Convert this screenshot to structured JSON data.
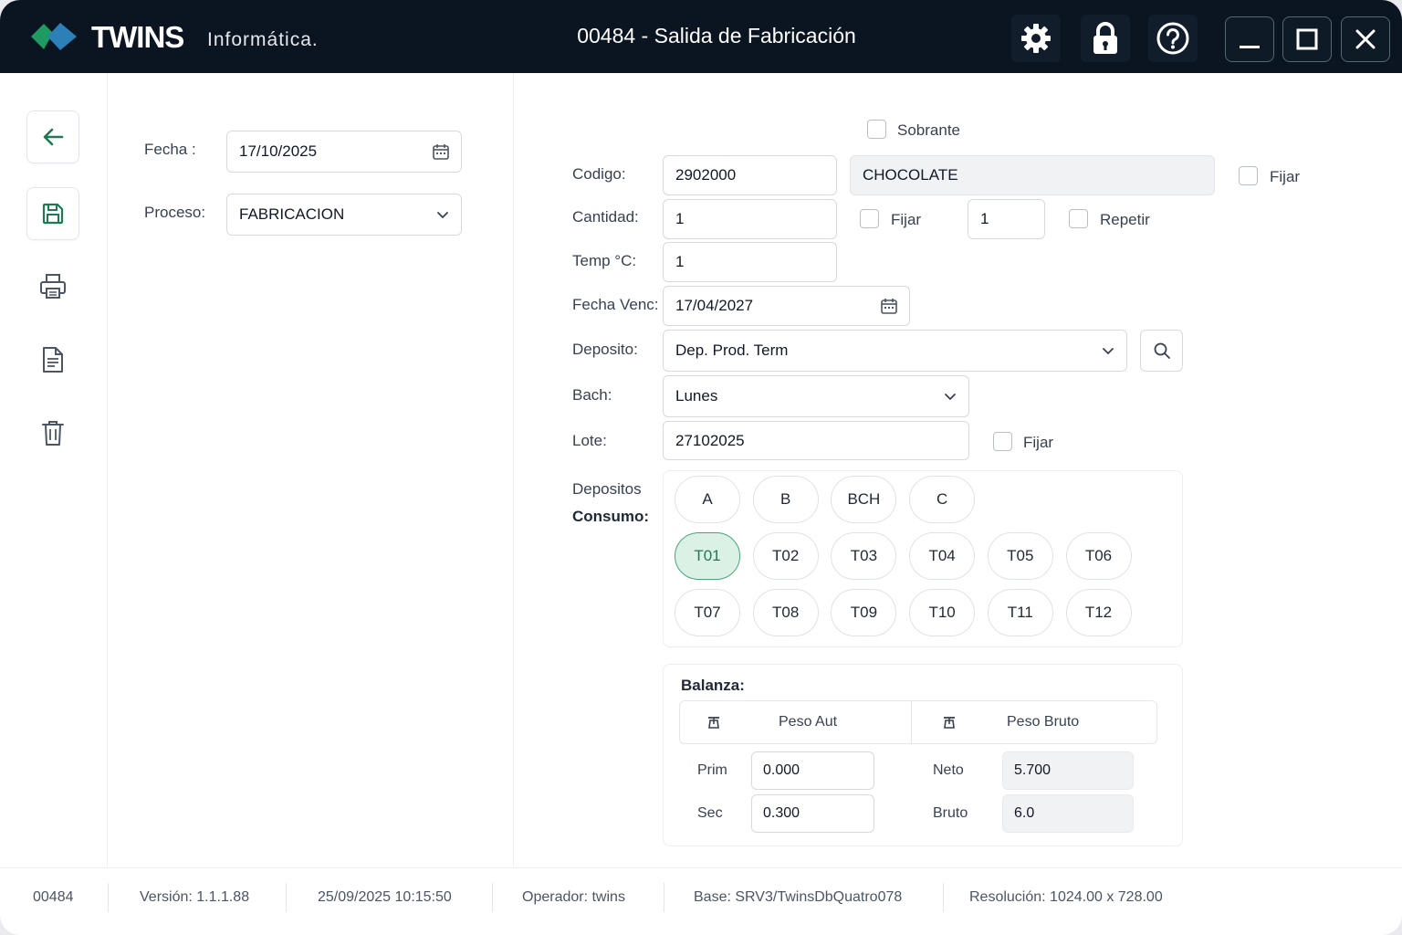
{
  "titlebar": {
    "brand": "TWINS",
    "brand_sub": "Informática.",
    "title": "00484 - Salida de Fabricación"
  },
  "icons": {
    "settings": "gear-icon",
    "lock": "lock-icon",
    "help": "help-icon",
    "minimize": "minimize-icon",
    "maximize": "maximize-icon",
    "close": "close-icon",
    "back": "arrow-left-icon",
    "save": "save-icon",
    "print": "printer-icon",
    "document": "document-icon",
    "delete": "trash-icon"
  },
  "left": {
    "fecha_label": "Fecha :",
    "fecha_value": "17/10/2025",
    "proceso_label": "Proceso:",
    "proceso_value": "FABRICACION"
  },
  "form": {
    "sobrante_label": "Sobrante",
    "codigo_label": "Codigo:",
    "codigo_value": "2902000",
    "descripcion_value": "CHOCOLATE",
    "fijar_codigo_label": "Fijar",
    "cantidad_label": "Cantidad:",
    "cantidad_value": "1",
    "fijar_cantidad_label": "Fijar",
    "repetir_value": "1",
    "repetir_label": "Repetir",
    "temp_label": "Temp °C:",
    "temp_value": "1",
    "fecha_venc_label": "Fecha Venc:",
    "fecha_venc_value": "17/04/2027",
    "deposito_label": "Deposito:",
    "deposito_value": "Dep. Prod. Term",
    "bach_label": "Bach:",
    "bach_value": "Lunes",
    "lote_label": "Lote:",
    "lote_value": "27102025",
    "fijar_lote_label": "Fijar",
    "depositos_label_1": "Depositos",
    "depositos_label_2": "Consumo:"
  },
  "depositos": {
    "row1": [
      "A",
      "B",
      "BCH",
      "C"
    ],
    "row2": [
      "T01",
      "T02",
      "T03",
      "T04",
      "T05",
      "T06"
    ],
    "row3": [
      "T07",
      "T08",
      "T09",
      "T10",
      "T11",
      "T12"
    ],
    "selected": "T01"
  },
  "balanza": {
    "title": "Balanza:",
    "peso_aut": "Peso Aut",
    "peso_bruto": "Peso Bruto",
    "prim_label": "Prim",
    "prim_value": "0.000",
    "sec_label": "Sec",
    "sec_value": "0.300",
    "neto_label": "Neto",
    "neto_value": "5.700",
    "bruto_label": "Bruto",
    "bruto_value": "6.0"
  },
  "status": {
    "code": "00484",
    "version": "Versión: 1.1.1.88",
    "datetime": "25/09/2025 10:15:50",
    "operador": "Operador: twins",
    "base": "Base: SRV3/TwinsDbQuatro078",
    "resolucion": "Resolución: 1024.00 x 728.00"
  },
  "colors": {
    "titlebar_bg": "#0b1521",
    "accent_green": "#1f7a52",
    "active_pill_bg": "#dcf1e6"
  }
}
